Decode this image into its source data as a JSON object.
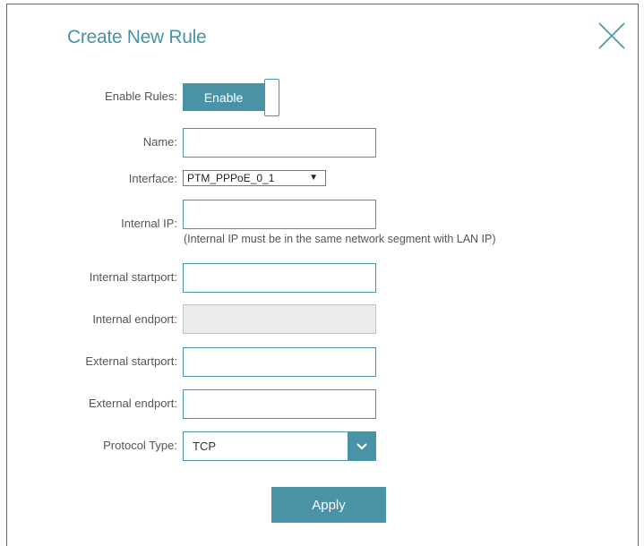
{
  "dialog": {
    "title": "Create New Rule",
    "close_icon": "close-icon"
  },
  "form": {
    "enable_rules_label": "Enable Rules:",
    "enable_button_label": "Enable",
    "name_label": "Name:",
    "name_value": "",
    "interface_label": "Interface:",
    "interface_selected": "PTM_PPPoE_0_1",
    "interface_arrow": "▼",
    "internal_ip_label": "Internal IP:",
    "internal_ip_value": "",
    "internal_ip_hint": "(Internal IP must be in the same network segment with LAN IP)",
    "internal_startport_label": "Internal startport:",
    "internal_startport_value": "",
    "internal_endport_label": "Internal endport:",
    "internal_endport_value": "",
    "external_startport_label": "External startport:",
    "external_startport_value": "",
    "external_endport_label": "External endport:",
    "external_endport_value": "",
    "protocol_type_label": "Protocol Type:",
    "protocol_type_selected": "TCP",
    "apply_label": "Apply"
  },
  "colors": {
    "accent": "#4a93a6",
    "disabled_field": "#ebebeb"
  }
}
